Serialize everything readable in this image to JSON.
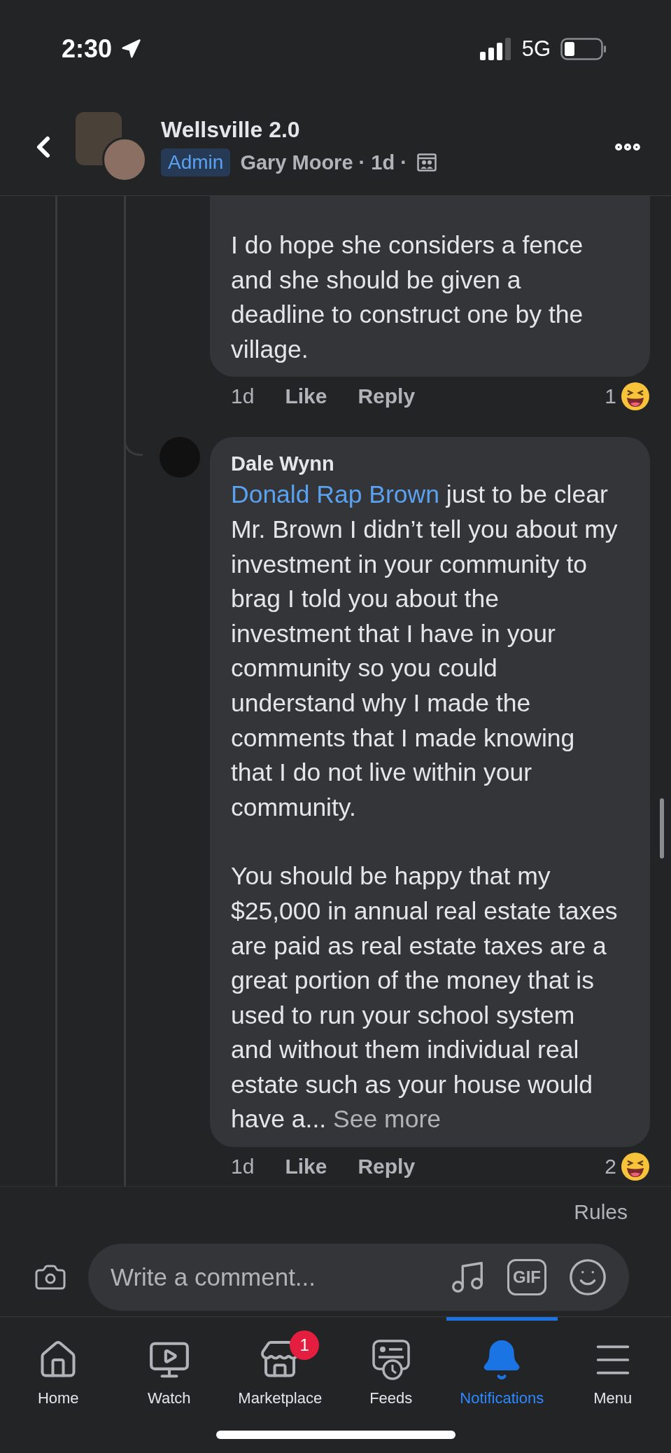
{
  "status_bar": {
    "time": "2:30",
    "network": "5G"
  },
  "header": {
    "title": "Wellsville 2.0",
    "role_badge": "Admin",
    "meta": "Gary Moore · 1d ·"
  },
  "comments": [
    {
      "paragraphs": [
        "I do hope she considers a fence and she should be given a deadline to construct one by the village."
      ],
      "time": "1d",
      "like": "Like",
      "reply": "Reply",
      "reaction_count": "1"
    },
    {
      "author": "Dale Wynn",
      "mention": "Donald Rap Brown",
      "paragraphs": [
        "just to be clear Mr. Brown I didn’t tell you about my investment in your community to brag I told you about the investment that I have in your community so you could understand why I made the comments that I made knowing that I do not live within your community.",
        "You should be happy that my $25,000 in annual real estate taxes are paid as real estate taxes are a great portion of the money that is used to run your school system and without them individual real estate such as your house would have a..."
      ],
      "see_more": "See more",
      "time": "1d",
      "like": "Like",
      "reply": "Reply",
      "reaction_count": "2"
    }
  ],
  "rules_link": "Rules",
  "composer": {
    "placeholder": "Write a comment...",
    "gif": "GIF"
  },
  "tabs": [
    {
      "kind": "home",
      "label": "Home",
      "selected": false
    },
    {
      "kind": "watch",
      "label": "Watch",
      "selected": false
    },
    {
      "kind": "marketplace",
      "label": "Marketplace",
      "selected": false,
      "badge": "1"
    },
    {
      "kind": "feeds",
      "label": "Feeds",
      "selected": false
    },
    {
      "kind": "notifications",
      "label": "Notifications",
      "selected": true
    },
    {
      "kind": "menu",
      "label": "Menu",
      "selected": false
    }
  ]
}
